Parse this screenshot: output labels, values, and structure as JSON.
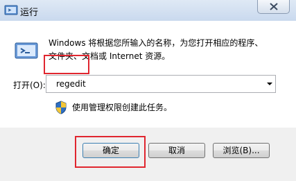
{
  "window": {
    "title": "运行",
    "close_symbol": "✕"
  },
  "description": {
    "line1": "Windows 将根据您所输入的名称，为您打开相应的程序、",
    "line2": "文件夹、文档或 Internet 资源。"
  },
  "open_field": {
    "label": "打开(O):",
    "value": "regedit",
    "dropdown_icon": "chevron-down-icon"
  },
  "admin_note": {
    "text": "使用管理权限创建此任务。",
    "icon": "uac-shield-icon"
  },
  "buttons": {
    "ok": "确定",
    "cancel": "取消",
    "browse": "浏览(B)..."
  },
  "colors": {
    "highlight": "#e0262f",
    "titlebar": "#c9d9ee"
  }
}
